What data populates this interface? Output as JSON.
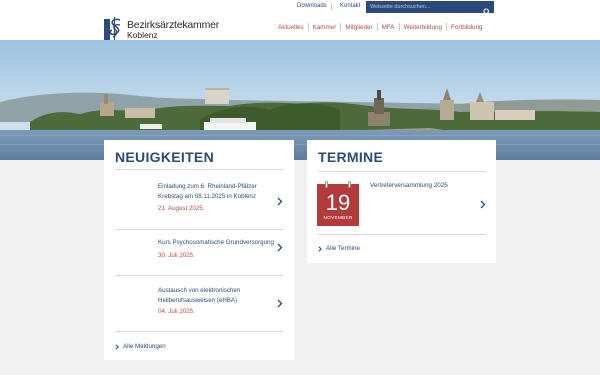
{
  "topbar": {
    "links": [
      "Downloads",
      "Kontakt"
    ],
    "search_placeholder": "Webseite durchsuchen..."
  },
  "header": {
    "brand_line1": "Bezirksärztekammer",
    "brand_line2": "Koblenz",
    "nav": [
      "Aktuelles",
      "Kammer",
      "Mitglieder",
      "MFA",
      "Weiterbildung",
      "Fortbildung"
    ]
  },
  "news": {
    "title": "NEUIGKEITEN",
    "items": [
      {
        "title": "Einladung zum 6. Rheinland-Pfälzer Krebstag am 08.11.2025 in Koblenz",
        "date": "21. August 2025."
      },
      {
        "title": "Kurs Psychosomatische Grundversorgung",
        "date": "30. Juli 2025."
      },
      {
        "title": "Austausch von elektronischen Heilberufsausweisen (eHBA)",
        "date": "04. Juli 2025."
      }
    ],
    "more": "Alle Meldungen"
  },
  "events": {
    "title": "TERMINE",
    "items": [
      {
        "day": "19",
        "month": "NOVEMBER",
        "title": "Vertreterversammlung 2025"
      }
    ],
    "more": "Alle Termine"
  },
  "colors": {
    "primary_blue": "#2b4b7c",
    "accent_red": "#b64a4a",
    "calendar_red": "#b33a3a",
    "page_bg": "#f1f1f1"
  },
  "icons": [
    "search-icon",
    "logo-icon",
    "chevron-right-icon",
    "calendar-icon"
  ]
}
